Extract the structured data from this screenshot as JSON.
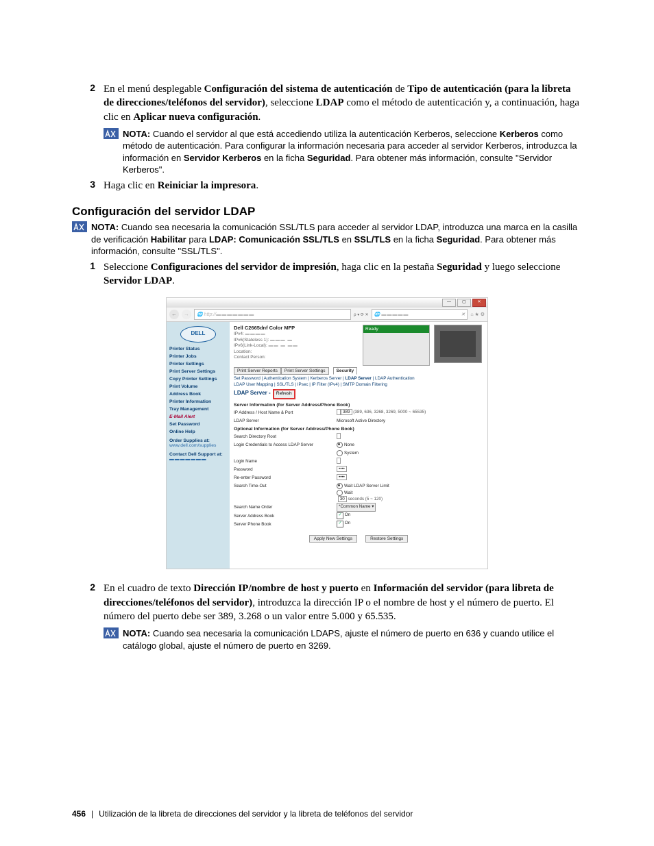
{
  "steps_a": {
    "s2": {
      "n": "2",
      "txt": "En el menú desplegable Configuración del sistema de autenticación de Tipo de autenticación (para la libreta de direcciones/teléfonos del servidor), seleccione LDAP como el método de autenticación y, a continuación, haga clic en Aplicar nueva configuración."
    },
    "note2": "NOTA: Cuando el servidor al que está accediendo utiliza la autenticación Kerberos, seleccione Kerberos como método de autenticación. Para configurar la información necesaria para acceder al servidor Kerberos, introduzca la información en Servidor Kerberos en la ficha Seguridad. Para obtener más información, consulte \"Servidor Kerberos\".",
    "s3": {
      "n": "3",
      "txt": "Haga clic en Reiniciar la impresora."
    }
  },
  "sect": "Configuración del servidor LDAP",
  "note_sect": "NOTA: Cuando sea necesaria la comunicación SSL/TLS para acceder al servidor LDAP, introduzca una marca en la casilla de verificación Habilitar para LDAP: Comunicación SSL/TLS en SSL/TLS en la ficha Seguridad. Para obtener más información, consulte \"SSL/TLS\".",
  "steps_b": {
    "s1": {
      "n": "1",
      "txt": "Seleccione Configuraciones del servidor de impresión, haga clic en la pestaña Seguridad y luego seleccione Servidor LDAP."
    },
    "s2": {
      "n": "2",
      "txt": "En el cuadro de texto Dirección IP/nombre de host y puerto en Información del servidor (para libreta de direcciones/teléfonos del servidor), introduzca la dirección IP o el nombre de host y el número de puerto. El número del puerto debe ser 389, 3.268 o un valor entre 5.000 y 65.535."
    },
    "note2": "NOTA: Cuando sea necesaria la comunicación LDAPS, ajuste el número de puerto en 636 y cuando utilice el catálogo global, ajuste el número de puerto en 3269."
  },
  "footer": {
    "page": "456",
    "title": "Utilización de la libreta de direcciones del servidor y la libreta de teléfonos del servidor"
  },
  "shot": {
    "logo": "DELL",
    "url_prefix": "http://",
    "url_tools": "ρ ▾  ⟳ ✕",
    "status": "Ready",
    "sidebar": [
      "Printer Status",
      "Printer Jobs",
      "Printer Settings",
      "Print Server Settings",
      "Copy Printer Settings",
      "Print Volume",
      "Address Book",
      "Printer Information",
      "Tray Management",
      "E-Mail Alert",
      "Set Password",
      "Online Help"
    ],
    "side_order_lbl": "Order Supplies at:",
    "side_order_url": "www.dell.com/supplies",
    "side_support_lbl": "Contact Dell Support at:",
    "model": "Dell C2665dnf Color MFP",
    "info_rows": [
      "IPv4:",
      "IPv6(Stateless 1):",
      "IPv6(Link-Local):",
      "Location:",
      "Contact Person:"
    ],
    "tab1": "Print Server Reports",
    "tab2": "Print Server Settings",
    "tab3": "Security",
    "links1": {
      "a": "Set Password",
      "b": "Authentication System",
      "c": "Kerberos Server",
      "d": "LDAP Server",
      "e": "LDAP Authentication"
    },
    "links2": {
      "a": "LDAP User Mapping",
      "b": "SSL/TLS",
      "c": "IPsec",
      "d": "IP Filter (IPv4)",
      "e": "SMTP Domain Filtering"
    },
    "title": "LDAP Server - ",
    "refresh": "Refresh",
    "hdr1": "Server Information (for Server Address/Phone Book)",
    "r_ip": "IP Address / Host Name & Port",
    "port": "389",
    "port_hint": "(389, 636, 3268, 3269, 5000 ~ 65535)",
    "r_srv": "LDAP Server",
    "srv_val": "Microsoft Active Directory",
    "hdr2": "Optional Information (for Server Address/Phone Book)",
    "r_root": "Search Directory Root",
    "r_cred": "Login Credentials to Access LDAP Server",
    "cred_a": "None",
    "cred_b": "System",
    "r_login": "Login Name",
    "r_pw": "Password",
    "pw": "••••",
    "r_pw2": "Re-enter Password",
    "r_to": "Search Time-Out",
    "to_a": "Wait LDAP Server Limit",
    "to_b": "Wait",
    "to_val": "30",
    "to_suf": "seconds (5 ~ 120)",
    "r_order": "Search Name Order",
    "order_val": "*Common Name  ▾",
    "r_ab": "Server Address Book",
    "on": "On",
    "r_pb": "Server Phone Book",
    "apply": "Apply New Settings",
    "restore": "Restore Settings"
  }
}
